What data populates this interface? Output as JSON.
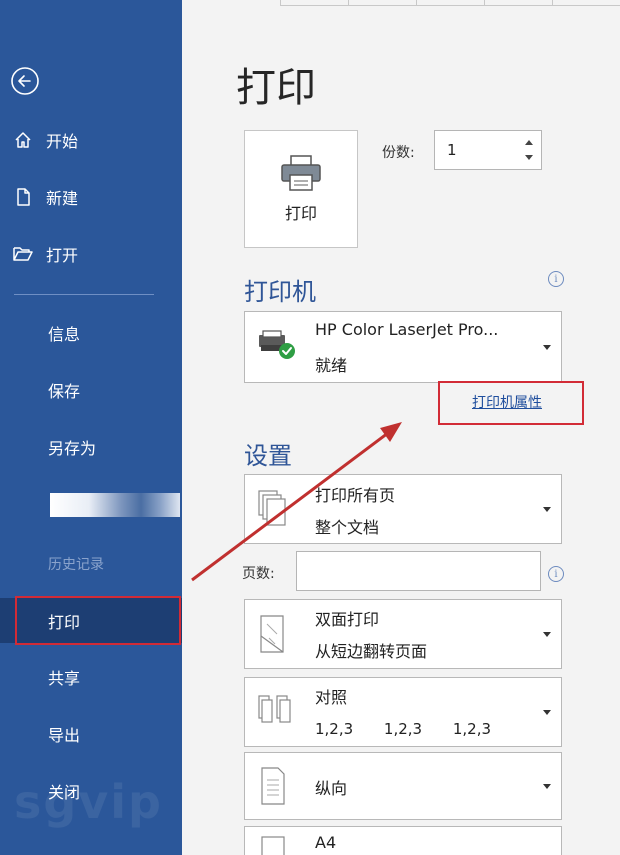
{
  "sidebar": {
    "items": [
      {
        "label": "开始"
      },
      {
        "label": "新建"
      },
      {
        "label": "打开"
      },
      {
        "label": "信息"
      },
      {
        "label": "保存"
      },
      {
        "label": "另存为"
      },
      {
        "label": "历史记录"
      },
      {
        "label": "打印"
      },
      {
        "label": "共享"
      },
      {
        "label": "导出"
      },
      {
        "label": "关闭"
      }
    ],
    "watermark": "sgvip"
  },
  "main": {
    "title": "打印",
    "print_button_label": "打印",
    "copies": {
      "label": "份数:",
      "value": "1"
    }
  },
  "printer": {
    "heading": "打印机",
    "name": "HP Color LaserJet Pro...",
    "status": "就绪",
    "properties_link": "打印机属性"
  },
  "settings": {
    "heading": "设置",
    "print_range": {
      "line1": "打印所有页",
      "line2": "整个文档"
    },
    "pages": {
      "label": "页数:",
      "value": ""
    },
    "duplex": {
      "line1": "双面打印",
      "line2": "从短边翻转页面"
    },
    "collate": {
      "line1": "对照",
      "line2": "1,2,3 1,2,3 1,2,3"
    },
    "orientation": {
      "line1": "纵向"
    },
    "paper": {
      "line1": "A4"
    }
  },
  "colors": {
    "sidebar": "#2b579a",
    "accent_text": "#2f5597",
    "highlight_red": "#d22b36"
  }
}
